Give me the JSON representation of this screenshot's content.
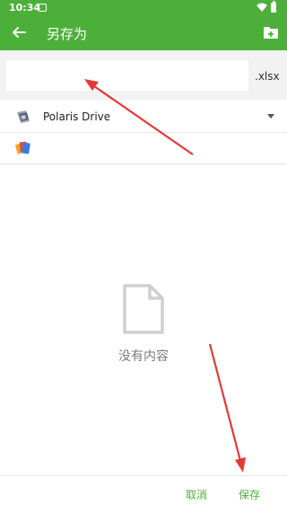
{
  "status_bar": {
    "time": "10:34"
  },
  "app_bar": {
    "title": "另存为"
  },
  "filename": {
    "value": "",
    "extension": ".xlsx"
  },
  "locations": [
    {
      "label": "Polaris Drive",
      "icon": "polaris-drive-icon"
    },
    {
      "label": "",
      "icon": "polaris-office-icon"
    }
  ],
  "empty_state": {
    "text": "没有内容",
    "icon": "empty-document-icon"
  },
  "bottom_bar": {
    "cancel_label": "取消",
    "save_label": "保存"
  },
  "colors": {
    "primary": "#4caf3a",
    "annotation_arrow": "#e53935"
  }
}
